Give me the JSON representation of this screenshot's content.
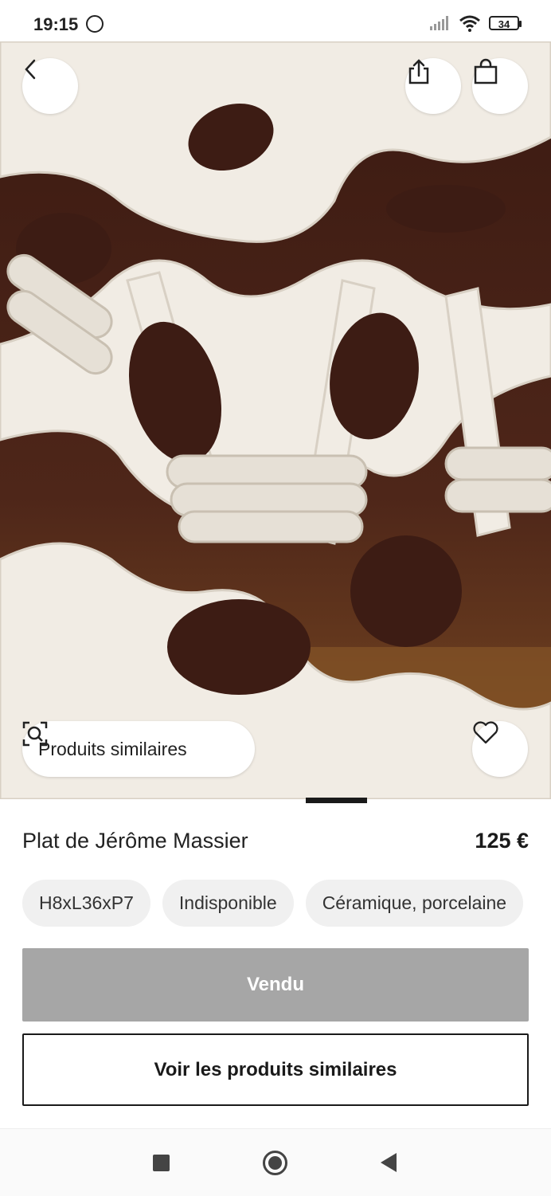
{
  "status_bar": {
    "time": "19:15",
    "battery": "34",
    "icons": [
      "nfc-icon",
      "signal-icon",
      "wifi-icon",
      "battery-icon"
    ]
  },
  "toolbar": {
    "back_icon": "chevron-left-icon",
    "share_icon": "share-icon",
    "cart_icon": "shopping-bag-icon"
  },
  "hero": {
    "similar_products_label": "Produits similaires",
    "similar_icon": "visual-search-icon",
    "favorite_icon": "heart-icon"
  },
  "product": {
    "title": "Plat de Jérôme Massier",
    "price": "125 €",
    "chips": [
      "H8xL36xP7",
      "Indisponible",
      "Céramique, porcelaine"
    ]
  },
  "actions": {
    "sold_label": "Vendu",
    "see_similar_label": "Voir les produits similaires"
  },
  "nav": {
    "icons": [
      "recent-apps-icon",
      "home-icon",
      "back-icon"
    ]
  },
  "colors": {
    "sold_button": "#a6a6a6",
    "ceramic": "#f2ede6",
    "background_wood": "#4a2418"
  }
}
